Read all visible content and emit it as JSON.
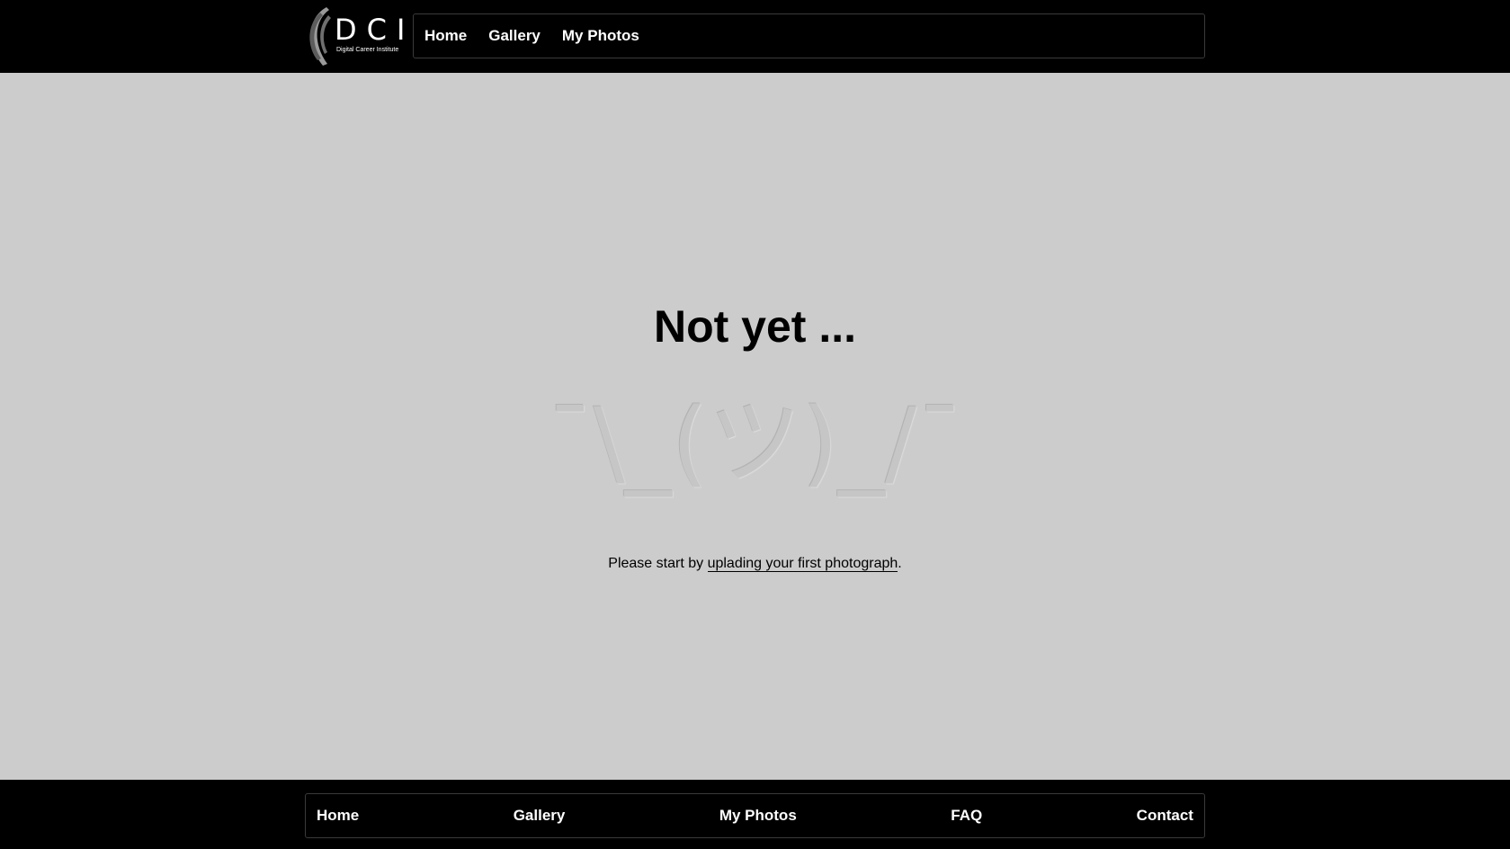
{
  "header": {
    "logo": {
      "letters": "DCI",
      "subtitle": "Digital Career Institute"
    },
    "nav": [
      {
        "label": "Home"
      },
      {
        "label": "Gallery"
      },
      {
        "label": "My Photos"
      }
    ]
  },
  "main": {
    "title": "Not yet ...",
    "shrug": "¯\\_(ツ)_/¯",
    "message": {
      "prefix": "Please start by ",
      "link": "uplading your first photograph",
      "suffix": "."
    }
  },
  "footer": {
    "nav": [
      {
        "label": "Home"
      },
      {
        "label": "Gallery"
      },
      {
        "label": "My Photos"
      },
      {
        "label": "FAQ"
      },
      {
        "label": "Contact"
      }
    ]
  },
  "colors": {
    "page_background": "#cccccc",
    "bar_background": "#000000",
    "nav_text": "#ffffff",
    "shrug": "#c6c6c6"
  }
}
